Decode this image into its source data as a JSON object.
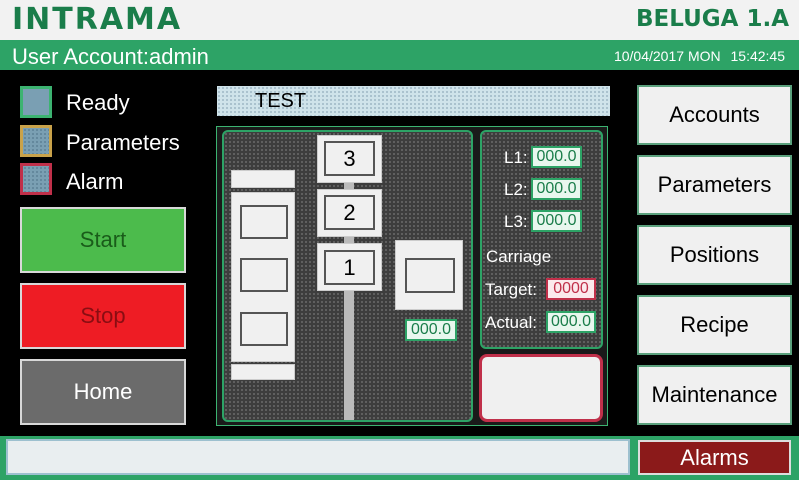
{
  "header": {
    "logo": "INTRAMA",
    "model": "BELUGA 1.A",
    "user_label": "User Account",
    "user_sep": ":",
    "user_name": "admin",
    "date": "10/04/2017",
    "weekday": "MON",
    "time": "15:42:45"
  },
  "legend": [
    {
      "label": "Ready",
      "color": "#7a9fb3",
      "border": "#3cb371"
    },
    {
      "label": "Parameters",
      "color": "#7a9fb3",
      "border": "#c9a24a"
    },
    {
      "label": "Alarm",
      "color": "#7a9fb3",
      "border": "#c0304a"
    }
  ],
  "left_buttons": {
    "start": "Start",
    "stop": "Stop",
    "home": "Home"
  },
  "title_field": "TEST",
  "diagram": {
    "levels": [
      "3",
      "2",
      "1"
    ],
    "carriage_value": "000.0"
  },
  "readouts": {
    "l1_label": "L1:",
    "l1_value": "000.0",
    "l2_label": "L2:",
    "l2_value": "000.0",
    "l3_label": "L3:",
    "l3_value": "000.0",
    "carriage_label": "Carriage",
    "target_label": "Target:",
    "target_value": "0000",
    "actual_label": "Actual:",
    "actual_value": "000.0"
  },
  "right_buttons": [
    "Accounts",
    "Parameters",
    "Positions",
    "Recipe",
    "Maintenance"
  ],
  "bottom": {
    "alarms": "Alarms",
    "status_text": ""
  },
  "colors": {
    "brand_green": "#2da366",
    "logo_green": "#1a7d4a",
    "start_green": "#4cbb4c",
    "stop_red": "#ee1c24",
    "home_gray": "#6b6b6b",
    "alarm_red": "#8b1a1a"
  }
}
